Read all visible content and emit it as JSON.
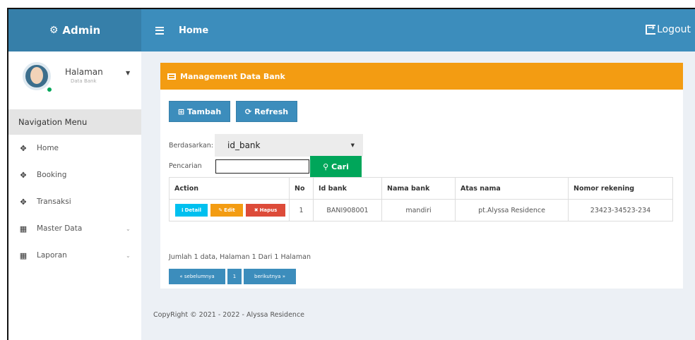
{
  "header": {
    "brand": "Admin",
    "page": "Home",
    "logout": "Logout"
  },
  "sidebar": {
    "user_name": "Halaman",
    "user_sub": "Data Bank",
    "nav_header": "Navigation Menu",
    "items": [
      {
        "label": "Home",
        "icon": "move-icon"
      },
      {
        "label": "Booking",
        "icon": "move-icon"
      },
      {
        "label": "Transaksi",
        "icon": "move-icon"
      },
      {
        "label": "Master Data",
        "icon": "grid-icon",
        "has_chevron": true
      },
      {
        "label": "Laporan",
        "icon": "grid-icon",
        "has_chevron": true
      }
    ]
  },
  "box": {
    "title": "Management Data Bank",
    "btn_tambah": "Tambah",
    "btn_refresh": "Refresh",
    "filter_label": "Berdasarkan:",
    "filter_value": "id_bank",
    "search_label": "Pencarian",
    "search_value": "",
    "btn_cari": "Cari"
  },
  "table": {
    "headers": [
      "Action",
      "No",
      "Id bank",
      "Nama bank",
      "Atas nama",
      "Nomor rekening"
    ],
    "row_actions": {
      "detail": "Detail",
      "edit": "Edit",
      "hapus": "Hapus"
    },
    "rows": [
      {
        "no": "1",
        "id_bank": "BANI908001",
        "nama_bank": "mandiri",
        "atas_nama": "pt.Alyssa Residence",
        "nomor_rekening": "23423-34523-234"
      }
    ]
  },
  "summary": "Jumlah 1 data, Halaman 1 Dari 1 Halaman",
  "pager": {
    "prev": "« sebelumnya",
    "page": "1",
    "next": "berikutnya »"
  },
  "footer": "CopyRight © 2021 - 2022 - Alyssa Residence",
  "colors": {
    "brand": "#367fa9",
    "navbar": "#3c8dbc",
    "box_header": "#f39c12",
    "cari": "#00a65a",
    "detail": "#00c0ef",
    "hapus": "#dd4b39"
  }
}
